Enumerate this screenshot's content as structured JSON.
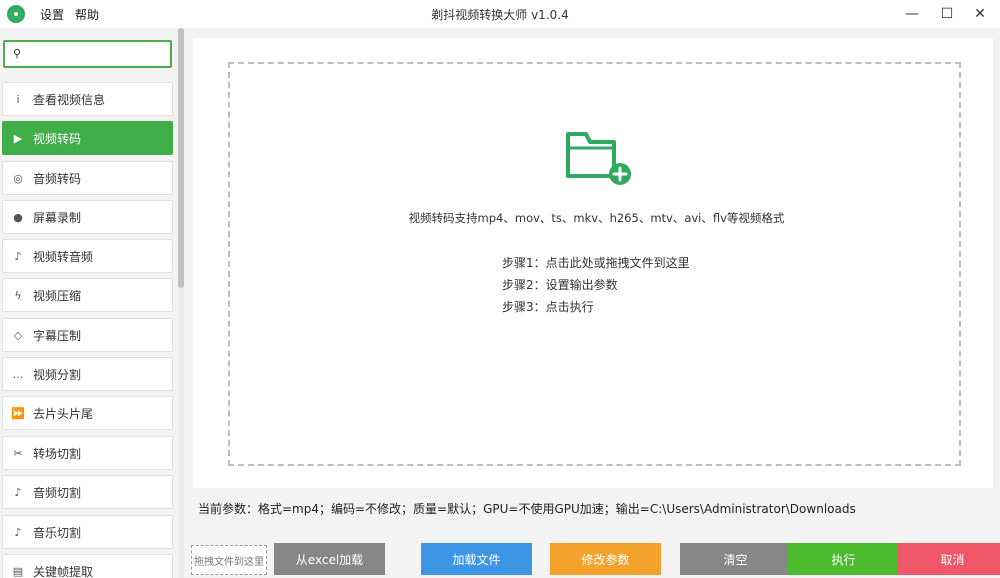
{
  "titlebar": {
    "title": "剃抖视频转换大师 v1.0.4",
    "menu": [
      "设置",
      "帮助"
    ],
    "minimize_glyph": "—",
    "maximize_glyph": "☐",
    "close_glyph": "✕"
  },
  "sidebar": {
    "search": {
      "value": "",
      "placeholder": ""
    },
    "items": [
      {
        "label": "查看视频信息",
        "icon": "info-icon",
        "glyph": "i"
      },
      {
        "label": "视频转码",
        "icon": "play-icon",
        "glyph": "▶"
      },
      {
        "label": "音频转码",
        "icon": "audio-icon",
        "glyph": "◎"
      },
      {
        "label": "屏幕录制",
        "icon": "record-icon",
        "glyph": "●"
      },
      {
        "label": "视频转音频",
        "icon": "music-note-icon",
        "glyph": "♪"
      },
      {
        "label": "视频压缩",
        "icon": "lightning-icon",
        "glyph": "ϟ"
      },
      {
        "label": "字幕压制",
        "icon": "diamond-icon",
        "glyph": "◇"
      },
      {
        "label": "视频分割",
        "icon": "ellipsis-icon",
        "glyph": "…"
      },
      {
        "label": "去片头片尾",
        "icon": "fast-forward-icon",
        "glyph": "⏩"
      },
      {
        "label": "转场切割",
        "icon": "scissors-icon",
        "glyph": "✂"
      },
      {
        "label": "音频切割",
        "icon": "music-note-icon",
        "glyph": "♪"
      },
      {
        "label": "音乐切割",
        "icon": "music-note-icon",
        "glyph": "♪"
      },
      {
        "label": "关键帧提取",
        "icon": "film-icon",
        "glyph": "▤"
      }
    ],
    "active_index": 1
  },
  "drop_zone": {
    "supported_formats": "视频转码支持mp4、mov、ts、mkv、h265、mtv、avi、flv等视频格式",
    "steps": [
      "步骤1：点击此处或拖拽文件到这里",
      "步骤2：设置输出参数",
      "步骤3：点击执行"
    ]
  },
  "status": {
    "params": "当前参数：格式=mp4；编码=不修改；质量=默认；GPU=不使用GPU加速；输出=C:\\Users\\Administrator\\Downloads"
  },
  "bottom": {
    "drag_hint": "拖拽文件到这里",
    "buttons": [
      {
        "label": "从excel加载",
        "color": "#878787"
      },
      {
        "label": "加载文件",
        "color": "#3d95e6"
      },
      {
        "label": "修改参数",
        "color": "#f3a22c"
      },
      {
        "label": "清空",
        "color": "#878787"
      },
      {
        "label": "执行",
        "color": "#4cbb2e"
      },
      {
        "label": "取消",
        "color": "#f0586a"
      }
    ]
  },
  "colors": {
    "accent": "#3fae49",
    "folder": "#2eaa5e"
  }
}
